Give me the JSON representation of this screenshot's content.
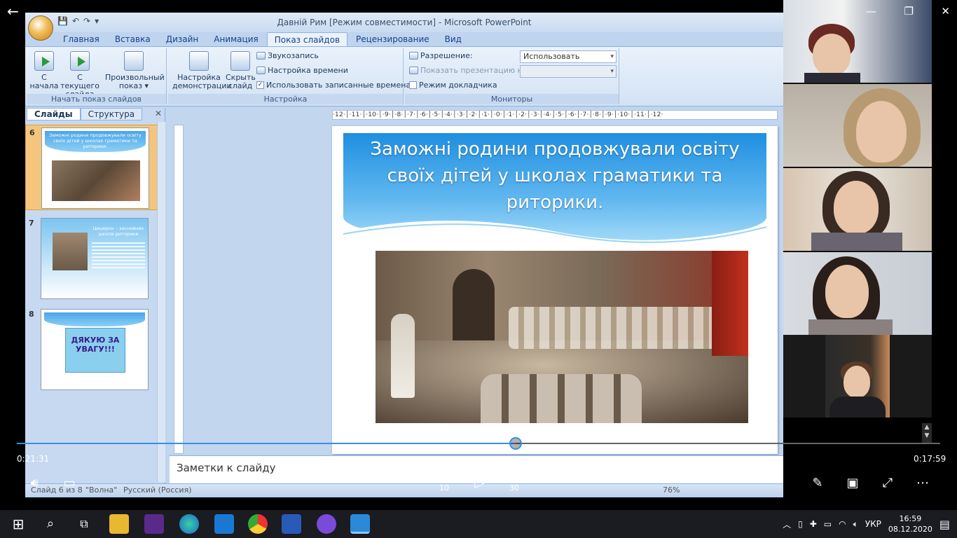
{
  "player": {
    "current_time": "0:21:31",
    "remaining_time": "0:17:59",
    "progress_fraction": 0.54,
    "skip_back_label": "10",
    "skip_forward_label": "30"
  },
  "ppt": {
    "window_title": "Давній Рим [Режим совместимости] - Microsoft PowerPoint",
    "tabs": [
      "Главная",
      "Вставка",
      "Дизайн",
      "Анимация",
      "Показ слайдов",
      "Рецензирование",
      "Вид"
    ],
    "active_tab": "Показ слайдов",
    "ribbon": {
      "from_start": "С\nначала",
      "from_current": "С текущего\nслайда",
      "custom_show": "Произвольный\nпоказ ▾",
      "group_start": "Начать показ слайдов",
      "setup_show": "Настройка\nдемонстрации",
      "hide_slide": "Скрыть\nслайд",
      "record_narration": "Звукозапись",
      "rehearse_timings": "Настройка времени",
      "use_timings": "Использовать записанные времена",
      "group_setup": "Настройка",
      "resolution_label": "Разрешение:",
      "resolution_value": "Использовать текуще...",
      "show_on_label": "Показать презентацию на:",
      "presenter_view": "Режим докладчика",
      "group_monitors": "Мониторы"
    },
    "pane_tabs": [
      "Слайды",
      "Структура"
    ],
    "thumbnails": [
      {
        "num": "6",
        "title": "Заможні родини продовжували освіту своїх дітей у школах граматики та риторики."
      },
      {
        "num": "7",
        "title": "Цицерон – засновник школи риторики"
      },
      {
        "num": "8",
        "title": "ДЯКУЮ ЗА УВАГУ!!!"
      }
    ],
    "slide_title": "Заможні родини продовжували освіту своїх дітей у школах граматики та риторики.",
    "ruler_text": "·12·│·11·│·10·│·9·│·8·│·7·│·6·│·5·│·4·│·3·│·2·│·1·│·0·│·1·│·2·│·3·│·4·│·5·│·6·│·7·│·8·│·9·│·10·│·11·│·12·",
    "notes_placeholder": "Заметки к слайду",
    "status_slide": "Слайд 6 из 8",
    "status_theme": "\"Волна\"",
    "status_lang": "Русский (Россия)",
    "status_zoom": "76%"
  },
  "taskbar": {
    "lang": "УКР",
    "time": "16:59",
    "date": "08.12.2020"
  },
  "colors": {
    "accent": "#3a8ee6",
    "ribbon_bg": "#d3e2f4",
    "banner_blue": "#1e8fe0"
  }
}
